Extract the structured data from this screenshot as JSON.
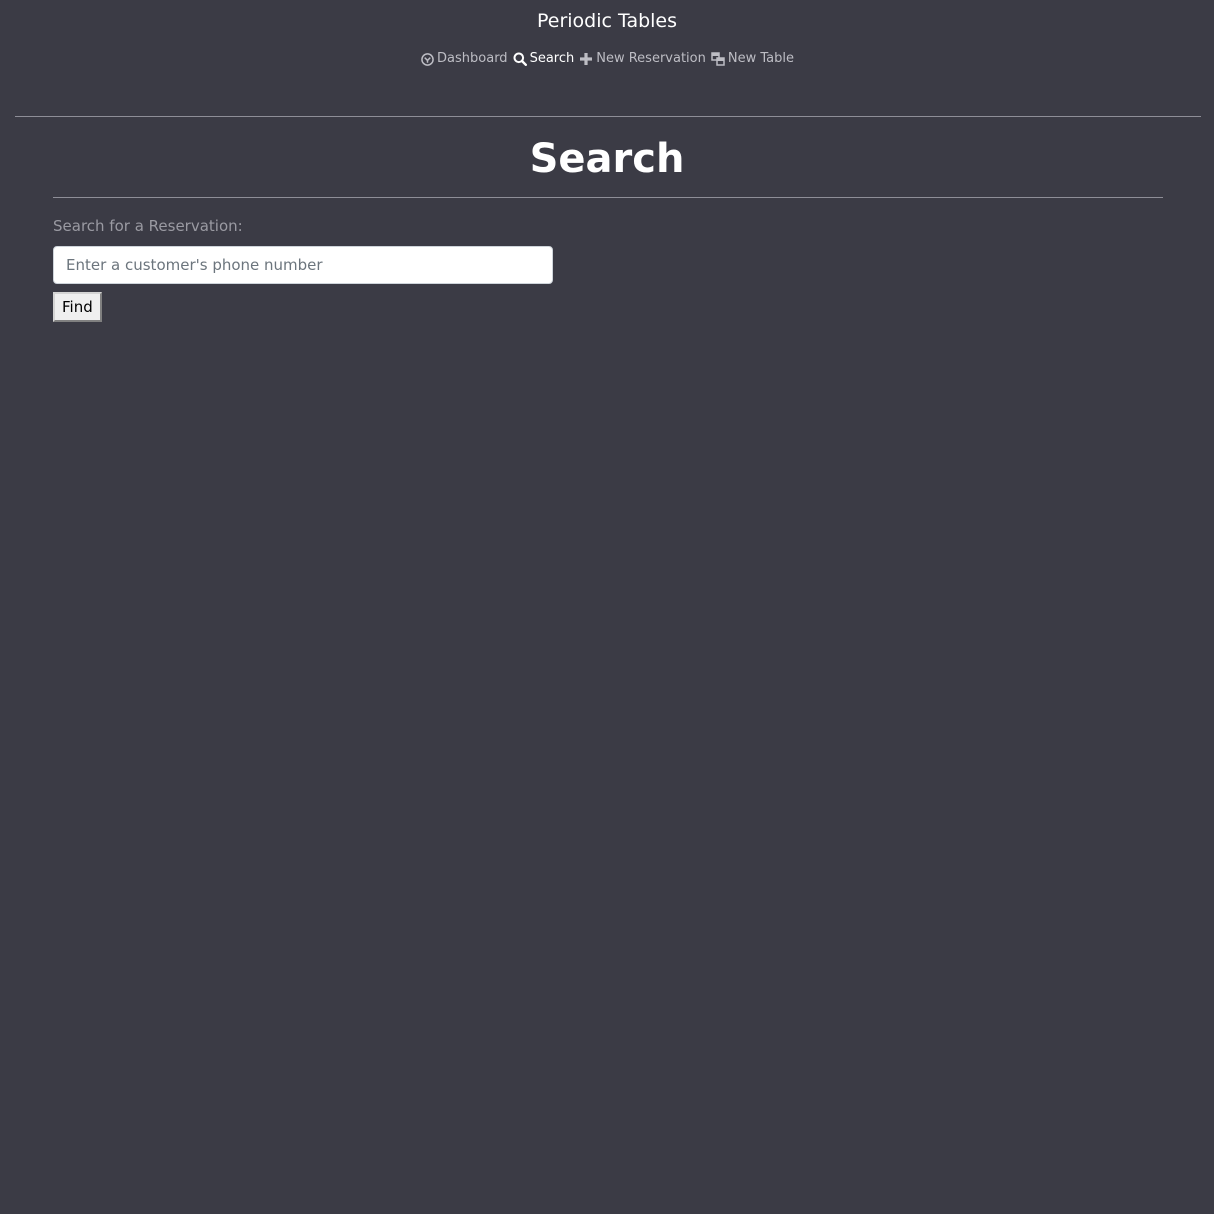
{
  "app": {
    "title": "Periodic Tables"
  },
  "nav": {
    "items": [
      {
        "label": "Dashboard",
        "icon": "dashboard-icon",
        "active": false
      },
      {
        "label": "Search",
        "icon": "search-icon",
        "active": true
      },
      {
        "label": "New Reservation",
        "icon": "plus-icon",
        "active": false
      },
      {
        "label": "New Table",
        "icon": "table-icon",
        "active": false
      }
    ]
  },
  "page": {
    "title": "Search"
  },
  "search": {
    "label": "Search for a Reservation:",
    "value": "",
    "placeholder": "Enter a customer's phone number",
    "button_label": "Find"
  },
  "colors": {
    "background": "#3b3b45",
    "text_primary": "#ffffff",
    "nav_inactive": "#bdbdc4",
    "label_muted": "#9a9aa2",
    "divider": "#8e8e97"
  }
}
